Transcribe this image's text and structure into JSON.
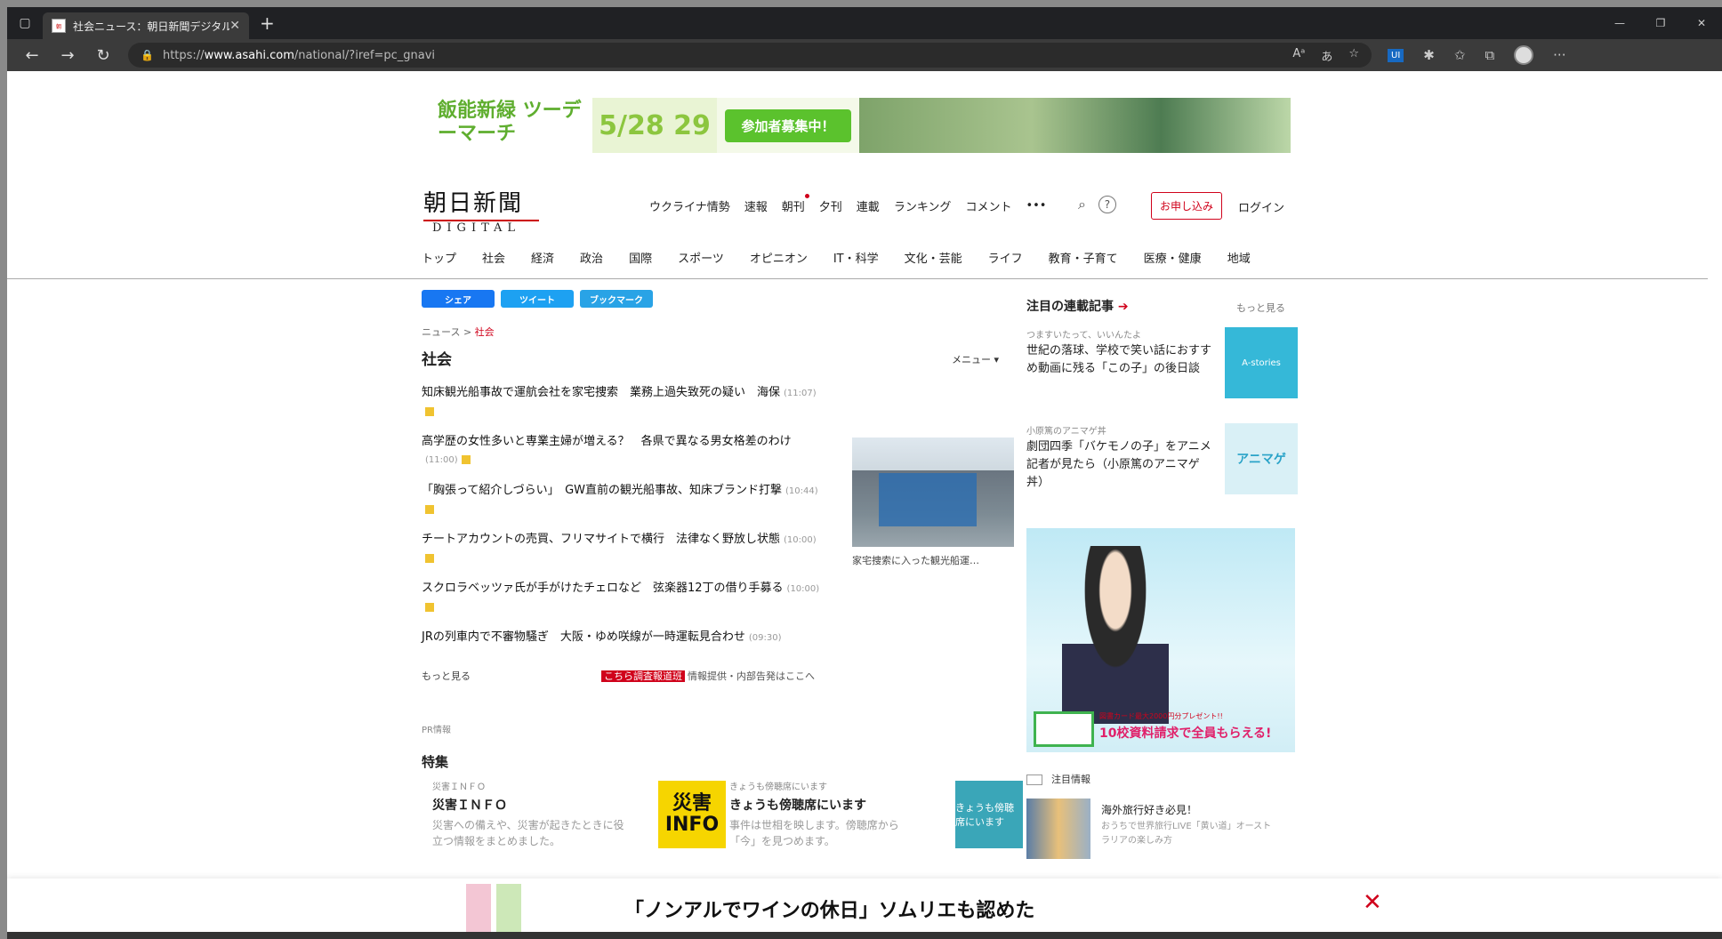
{
  "browser": {
    "tab_title": "社会ニュース：朝日新聞デジタル",
    "tab_close": "✕",
    "new_tab": "+",
    "url_prefix": "https://",
    "url_host": "www.asahi.com",
    "url_path": "/national/?iref=pc_gnavi",
    "read_aloud": "A̩",
    "translate": "あ",
    "ui_badge": "UI"
  },
  "banner": {
    "event_name": "飯能新緑 ツーデーマーチ",
    "dates": "5/28 29",
    "cta": "参加者募集中！"
  },
  "logo": {
    "jp": "朝日新聞",
    "en": "DIGITAL"
  },
  "topnav": [
    "ウクライナ情勢",
    "速報",
    "朝刊",
    "夕刊",
    "連載",
    "ランキング",
    "コメント",
    "•••"
  ],
  "account": {
    "subscribe": "お申し込み",
    "login": "ログイン",
    "help": "?"
  },
  "catnav": [
    "トップ",
    "社会",
    "経済",
    "政治",
    "国際",
    "スポーツ",
    "オピニオン",
    "IT・科学",
    "文化・芸能",
    "ライフ",
    "教育・子育て",
    "医療・健康",
    "地域"
  ],
  "share": {
    "facebook": "シェア",
    "twitter": "ツイート",
    "hatena": "ブックマーク"
  },
  "breadcrumb": {
    "home": "ニュース",
    "sep": ">",
    "current": "社会"
  },
  "section": {
    "title": "社会",
    "menu": "メニュー ▾"
  },
  "articles": [
    {
      "title": "知床観光船事故で運航会社を家宅捜索　業務上過失致死の疑い　海保",
      "time": "(11:07)"
    },
    {
      "title": "高学歴の女性多いと専業主婦が増える？　各県で異なる男女格差のわけ",
      "time": "(11:00)"
    },
    {
      "title": "「胸張って紹介しづらい」　GW直前の観光船事故、知床ブランド打撃",
      "time": "(10:44)"
    },
    {
      "title": "チートアカウントの売買、フリマサイトで横行　法律なく野放し状態",
      "time": "(10:00)"
    },
    {
      "title": "スクロラベッツァ氏が手がけたチェロなど　弦楽器12丁の借り手募る",
      "time": "(10:00)"
    },
    {
      "title": "JRの列車内で不審物騒ぎ　大阪・ゆめ咲線が一時運転見合わせ",
      "time": "(09:30)"
    }
  ],
  "photo_caption": "家宅捜索に入った観光船運…",
  "more_link": "もっと見る",
  "tip": {
    "badge": "こちら調査報道班",
    "text": "情報提供・内部告発はここへ"
  },
  "pr_label": "PR情報",
  "features": {
    "title": "特集",
    "cards": [
      {
        "category": "災害ＩＮＦＯ",
        "title": "災害ＩＮＦＯ",
        "desc": "災害への備えや、災害が起きたときに役立つ情報をまとめました。",
        "img_text": "災害 INFO"
      },
      {
        "category": "きょうも傍聴席にいます",
        "title": "きょうも傍聴席にいます",
        "desc": "事件は世相を映します。傍聴席から「今」を見つめます。",
        "img_text": "きょうも傍聴席にいます"
      }
    ]
  },
  "right": {
    "heading": "注目の連載記事",
    "arrow": "➔",
    "more": "もっと見る",
    "items": [
      {
        "source": "つますいたって、いいんたよ",
        "text": "世紀の落球、学校で笑い話におすすめ動画に残る「この子」の後日談",
        "thumb": "A-stories"
      },
      {
        "source": "小原篤のアニマゲ丼",
        "text": "劇団四季「バケモノの子」をアニメ記者が見たら（小原篤のアニマゲ丼）",
        "thumb": "アニマゲ"
      }
    ],
    "ad_line1": "図書カード最大2000円分プレゼント!!",
    "ad_line2": "10校資料請求で全員もらえる!",
    "notice_label": "注目情報",
    "notice_item": {
      "title": "海外旅行好き必見！",
      "desc": "おうちで世界旅行LIVE「黄い道」オーストラリアの楽しみ方"
    }
  },
  "bottom_ad": {
    "text": "「ノンアルでワインの休日」ソムリエも認めた",
    "close": "✕"
  }
}
